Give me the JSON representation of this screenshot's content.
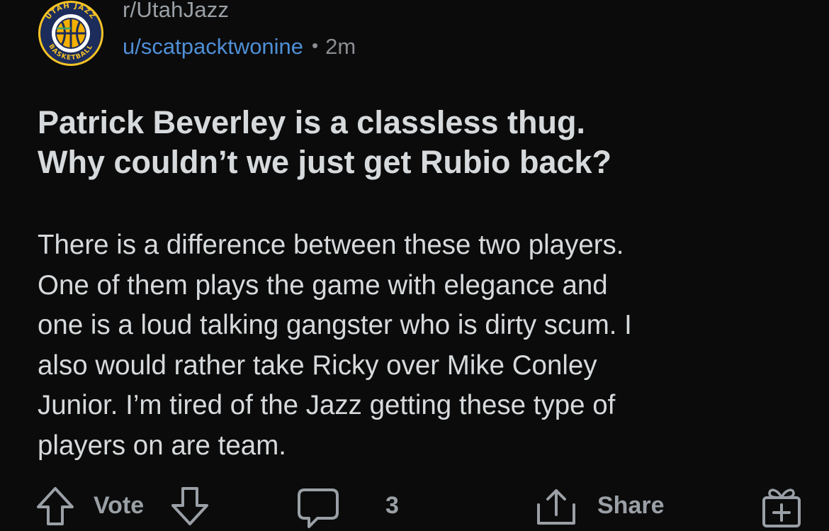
{
  "post": {
    "subreddit": "r/UtahJazz",
    "subreddit_avatar": {
      "icon": "utah-jazz-logo-icon",
      "ring_text_top": "UTAH JAZZ",
      "ring_text_bottom": "BASKETBALL",
      "colors": {
        "ring": "#1c2c5b",
        "accent": "#f9a01b",
        "ball": "#f4b000",
        "inner": "#ffffff"
      }
    },
    "author": "u/scatpacktwonine",
    "separator": "•",
    "age": "2m",
    "title_lines": [
      "Patrick Beverley is a classless thug.",
      "Why couldn’t we just get Rubio back?"
    ],
    "body_lines": [
      "There is a difference between these two players.",
      "One of them plays the game with elegance and",
      "one is a loud talking gangster who is dirty scum. I",
      "also would rather take Ricky over Mike Conley",
      "Junior. I’m tired of the Jazz getting these type of",
      "players on are team."
    ]
  },
  "actions": {
    "upvote_icon": "arrow-up-outline-icon",
    "vote_label": "Vote",
    "downvote_icon": "arrow-down-outline-icon",
    "comment_icon": "comment-bubble-icon",
    "comment_count": "3",
    "share_icon": "share-arrow-icon",
    "share_label": "Share",
    "award_icon": "gift-award-icon"
  },
  "theme": {
    "background": "#0b0b0b",
    "text_primary": "#d7dadc",
    "text_secondary": "#9aa0a6",
    "link": "#4f8fd6"
  }
}
